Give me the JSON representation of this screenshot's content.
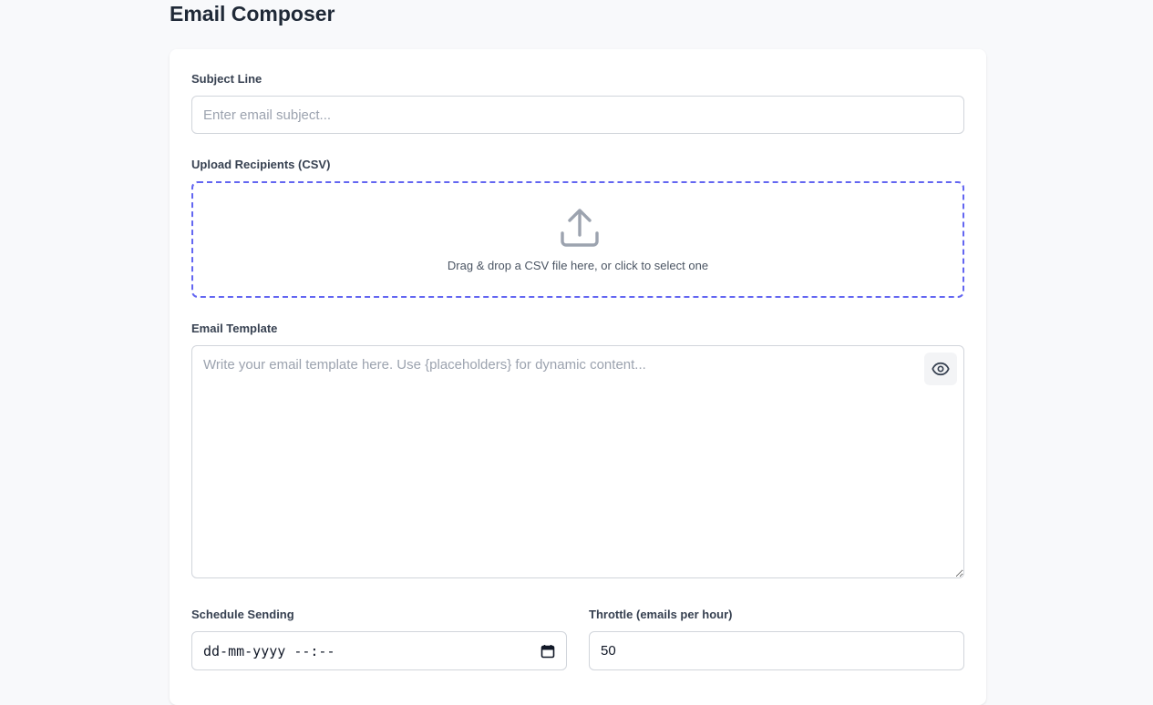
{
  "page": {
    "title": "Email Composer"
  },
  "subject": {
    "label": "Subject Line",
    "placeholder": "Enter email subject...",
    "value": ""
  },
  "upload": {
    "label": "Upload Recipients (CSV)",
    "icon": "upload-icon",
    "prompt": "Drag & drop a CSV file here, or click to select one"
  },
  "template": {
    "label": "Email Template",
    "placeholder": "Write your email template here. Use {placeholders} for dynamic content...",
    "value": "",
    "preview_icon": "eye-icon"
  },
  "schedule": {
    "label": "Schedule Sending",
    "value": "dd-mm-yyyy --:--",
    "icon": "calendar-icon"
  },
  "throttle": {
    "label": "Throttle (emails per hour)",
    "value": "50"
  },
  "colors": {
    "accent": "#6366f1",
    "background": "#f8f9fb",
    "card": "#ffffff",
    "border": "#d1d5db"
  }
}
